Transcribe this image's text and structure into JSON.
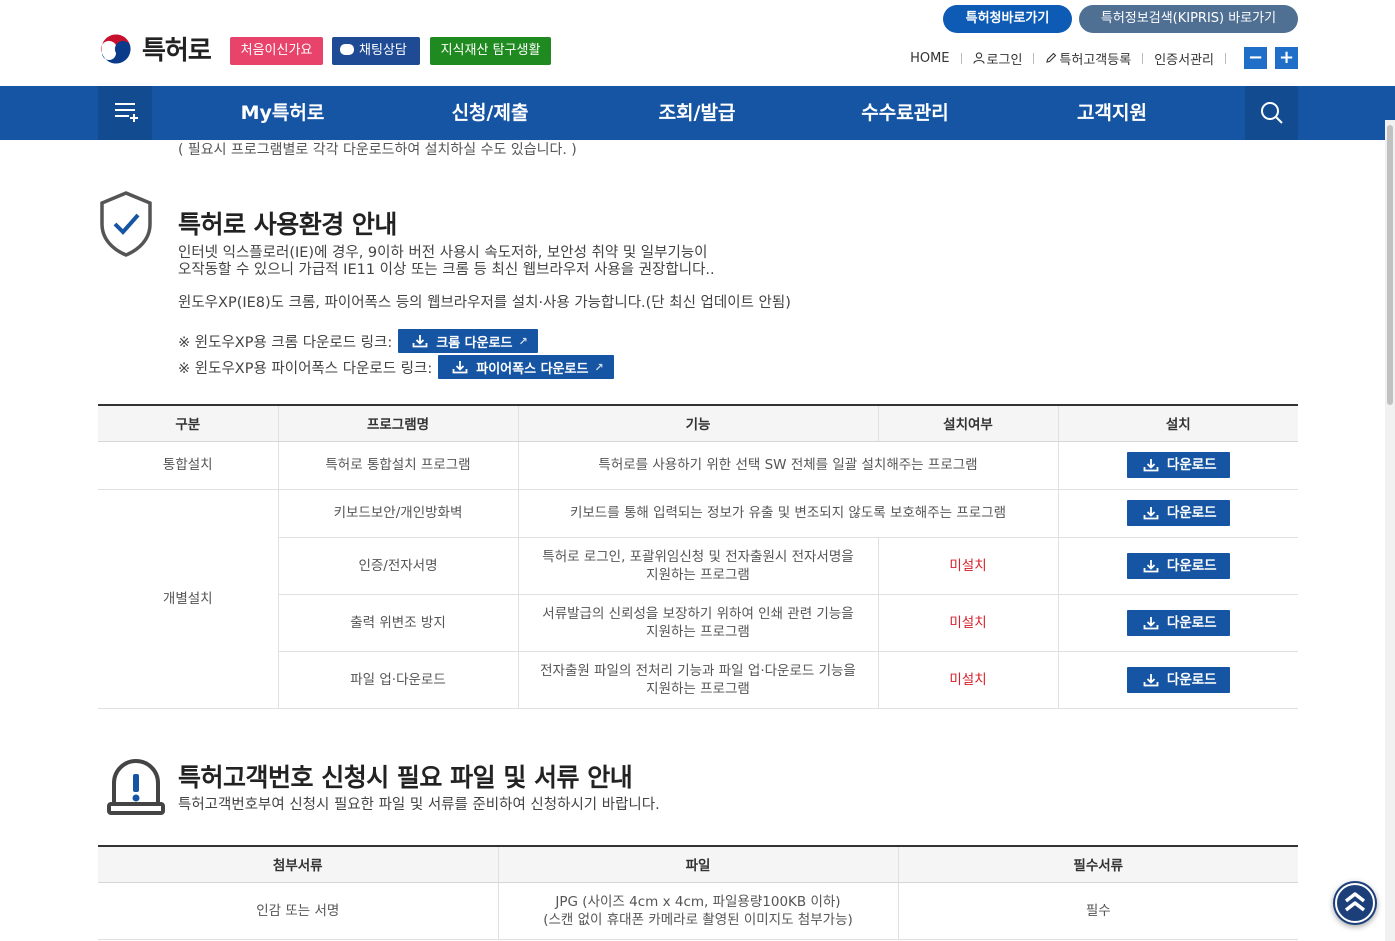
{
  "header": {
    "logo_text": "특허로",
    "buttons": {
      "first_visit": "처음이신가요",
      "chat": "채팅상담",
      "ip_explore": "지식재산 탐구생활"
    },
    "links": {
      "kipo": "특허청바로가기",
      "kipris": "특허정보검색(KIPRIS) 바로가기"
    },
    "util": {
      "home": "HOME",
      "login": "로그인",
      "register": "특허고객등록",
      "cert": "인증서관리"
    },
    "zoom": {
      "minus": "−",
      "plus": "+"
    }
  },
  "gnb": {
    "items": [
      "My특허로",
      "신청/제출",
      "조회/발급",
      "수수료관리",
      "고객지원"
    ]
  },
  "top_note": "( 필요시 프로그램별로 각각 다운로드하여 설치하실 수도 있습니다. )",
  "env_section": {
    "title": "특허로 사용환경 안내",
    "desc_line1": "인터넷 익스플로러(IE)에 경우, 9이하 버전 사용시 속도저하, 보안성 취약 및 일부기능이",
    "desc_line2": "오작동할 수 있으니 가급적 IE11 이상 또는 크롬 등 최신 웹브라우저 사용을 권장합니다..",
    "desc_line3": "윈도우XP(IE8)도 크롬, 파이어폭스 등의 웹브라우저를 설치·사용 가능합니다.(단 최신 업데이트 안됨)",
    "chrome_label": "※ 윈도우XP용 크롬 다운로드 링크:",
    "chrome_btn": "크롬 다운로드",
    "firefox_label": "※ 윈도우XP용 파이어폭스 다운로드 링크:",
    "firefox_btn": "파이어폭스 다운로드"
  },
  "program_table": {
    "headers": [
      "구분",
      "프로그램명",
      "기능",
      "설치여부",
      "설치"
    ],
    "download_label": "다운로드",
    "groups": {
      "integrated": "통합설치",
      "individual": "개별설치"
    },
    "rows": [
      {
        "name": "특허로 통합설치 프로그램",
        "func": "특허로를 사용하기 위한 선택 SW 전체를 일괄 설치해주는 프로그램",
        "status": ""
      },
      {
        "name": "키보드보안/개인방화벽",
        "func": "키보드를 통해 입력되는 정보가 유출 및 변조되지 않도록 보호해주는 프로그램",
        "status": ""
      },
      {
        "name": "인증/전자서명",
        "func_l1": "특허로 로그인, 포괄위임신청 및 전자출원시 전자서명을",
        "func_l2": "지원하는 프로그램",
        "status": "미설치"
      },
      {
        "name": "출력 위변조 방지",
        "func_l1": "서류발급의 신뢰성을 보장하기 위하여 인쇄 관련 기능을",
        "func_l2": "지원하는 프로그램",
        "status": "미설치"
      },
      {
        "name": "파일 업·다운로드",
        "func_l1": "전자출원 파일의 전처리 기능과 파일 업·다운로드 기능을",
        "func_l2": "지원하는 프로그램",
        "status": "미설치"
      }
    ]
  },
  "doc_section": {
    "title": "특허고객번호 신청시 필요 파일 및 서류 안내",
    "desc": "특허고객번호부여 신청시 필요한 파일 및 서류를 준비하여 신청하시기 바랍니다."
  },
  "doc_table": {
    "headers": [
      "첨부서류",
      "파일",
      "필수서류"
    ],
    "rows": [
      {
        "doc": "인감 또는 서명",
        "file_l1": "JPG (사이즈 4cm x 4cm, 파일용량100KB 이하)",
        "file_l2": "(스캔 없이 휴대폰 카메라로 촬영된 이미지도 첨부가능)",
        "required": "필수"
      }
    ]
  },
  "colors": {
    "gnb": "#1555a3",
    "accent_red": "#d6202b",
    "first_visit": "#e8436a",
    "chat": "#1f4b94",
    "ip": "#1f8a1f"
  }
}
